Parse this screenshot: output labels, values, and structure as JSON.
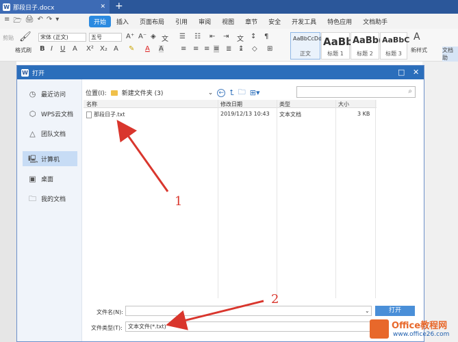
{
  "titlebar": {
    "tab_title": "那段日子.docx",
    "app_logo": "W"
  },
  "menubar": {
    "quick_access": [
      "≡",
      "🗁",
      "🖨",
      "↶",
      "↷",
      "▾"
    ],
    "items": [
      "开始",
      "插入",
      "页面布局",
      "引用",
      "审阅",
      "视图",
      "章节",
      "安全",
      "开发工具",
      "特色应用",
      "文档助手"
    ],
    "active": "开始"
  },
  "ribbon": {
    "format_painter": "格式刷",
    "paste_hint": "剪贴",
    "font_name": "宋体 (正文)",
    "font_size": "五号",
    "styles": [
      {
        "preview": "AaBbCcDd",
        "name": "正文"
      },
      {
        "preview": "AaBb",
        "name": "标题 1"
      },
      {
        "preview": "AaBb(",
        "name": "标题 2"
      },
      {
        "preview": "AaBbC",
        "name": "标题 3"
      }
    ],
    "new_style": "新样式",
    "text_tools": "文档助"
  },
  "dialog": {
    "title": "打开",
    "sidebar": [
      "最近访问",
      "WPS云文档",
      "团队文档",
      "计算机",
      "桌面",
      "我的文档"
    ],
    "sidebar_active": "计算机",
    "location_label": "位置(I):",
    "location_value": "新建文件夹 (3)",
    "columns": [
      "名称",
      "修改日期",
      "类型",
      "大小"
    ],
    "files": [
      {
        "name": "那段日子.txt",
        "date": "2019/12/13 10:43",
        "type": "文本文档",
        "size": "3 KB"
      }
    ],
    "filename_label": "文件名(N):",
    "filename_value": "",
    "filetype_label": "文件类型(T):",
    "filetype_value": "文本文件(*.txt)",
    "open_button": "打开"
  },
  "annotations": {
    "one": "1",
    "two": "2"
  },
  "watermark": {
    "title": "Office教程网",
    "url": "www.office26.com"
  },
  "colors": {
    "accent": "#2b6ebb",
    "annotation": "#d9362d",
    "watermark": "#e8682b"
  }
}
